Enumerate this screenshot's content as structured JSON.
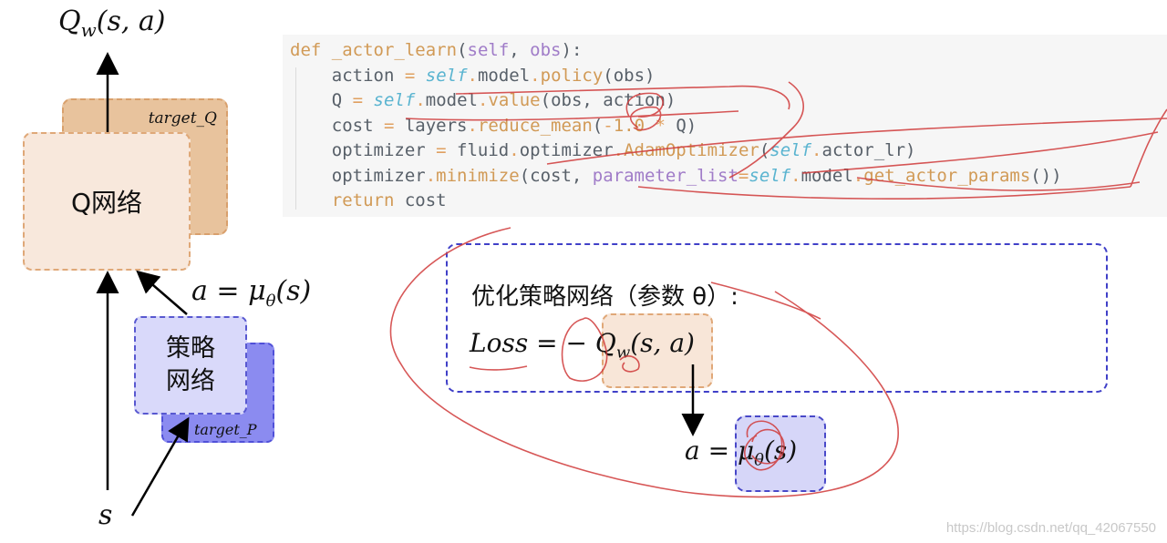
{
  "left_diagram": {
    "q_output_label": "Q_w(s,a)",
    "q_target_label": "target_Q",
    "q_network_label": "Q网络",
    "action_label": "a = μ_θ(s)",
    "policy_network_label_line1": "策略",
    "policy_network_label_line2": "网络",
    "policy_target_label": "target_P",
    "state_label": "s"
  },
  "code": {
    "lines": [
      "def _actor_learn(self, obs):",
      "    action = self.model.policy(obs)",
      "    Q = self.model.value(obs, action)",
      "    cost = layers.reduce_mean(-1.0 * Q)",
      "    optimizer = fluid.optimizer.AdamOptimizer(self.actor_lr)",
      "    optimizer.minimize(cost, parameter_list=self.model.get_actor_params())",
      "    return cost"
    ]
  },
  "optimization": {
    "title": "优化策略网络（参数 θ）:",
    "loss_lhs": "Loss",
    "loss_rhs": "= − Q_w(s,a)",
    "action_eq": "a = μ_θ(s)"
  },
  "colors": {
    "q_box": "#f8e8dc",
    "q_target_box": "#e8c39d",
    "policy_box": "#d9d9fa",
    "policy_target_box": "#8b8bf0",
    "annotation_red": "#d03a3a",
    "dashed_blue": "#4040c8"
  },
  "watermark": "https://blog.csdn.net/qq_42067550"
}
